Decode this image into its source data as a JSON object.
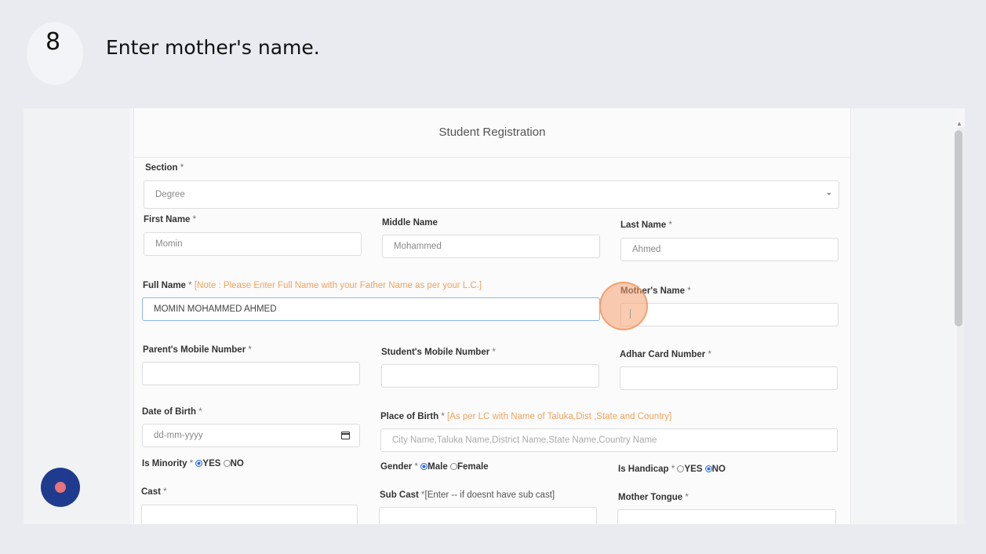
{
  "step": {
    "number": "8",
    "instruction": "Enter mother's name."
  },
  "form": {
    "title": "Student Registration",
    "section": {
      "label": "Section",
      "req": "*",
      "value": "Degree"
    },
    "first_name": {
      "label": "First Name",
      "req": "*",
      "value": "Momin"
    },
    "middle_name": {
      "label": "Middle Name",
      "value": "Mohammed"
    },
    "last_name": {
      "label": "Last Name",
      "req": "*",
      "value": "Ahmed"
    },
    "full_name": {
      "label": "Full Name",
      "req": "*",
      "note": "[Note : Please Enter Full Name with your Father Name as per your L.C.]",
      "value": "MOMIN MOHAMMED AHMED"
    },
    "mothers_name": {
      "label": "Mother's Name",
      "req": "*",
      "value": ""
    },
    "parents_mobile": {
      "label": "Parent's Mobile Number",
      "req": "*",
      "value": ""
    },
    "students_mobile": {
      "label": "Student's Mobile Number",
      "req": "*",
      "value": ""
    },
    "adhar": {
      "label": "Adhar Card Number",
      "req": "*",
      "value": ""
    },
    "dob": {
      "label": "Date of Birth",
      "req": "*",
      "placeholder": "dd-mm-yyyy"
    },
    "place_of_birth": {
      "label": "Place of Birth",
      "req": "*",
      "note": "[As per LC with Name of Taluka,Dist ,State and Country]",
      "placeholder": "City Name,Taluka Name,District Name,State Name,Country Name"
    },
    "minority": {
      "label": "Is Minority",
      "req": "*",
      "options": [
        "YES",
        "NO"
      ],
      "selected": "YES"
    },
    "gender": {
      "label": "Gender",
      "req": "*",
      "options": [
        "Male",
        "Female"
      ],
      "selected": "Male"
    },
    "handicap": {
      "label": "Is Handicap",
      "req": "*",
      "options": [
        "YES",
        "NO"
      ],
      "selected": "NO"
    },
    "cast": {
      "label": "Cast",
      "req": "*"
    },
    "sub_cast": {
      "label": "Sub Cast",
      "req": "*",
      "hint": "[Enter -- if doesnt have sub cast]"
    },
    "mother_tongue": {
      "label": "Mother Tongue",
      "req": "*"
    }
  },
  "colors": {
    "note": "#f0a35e",
    "click_highlight": "#f5a06e",
    "fab": "#1f3b8f",
    "radio_selected": "#2d6cdf"
  }
}
